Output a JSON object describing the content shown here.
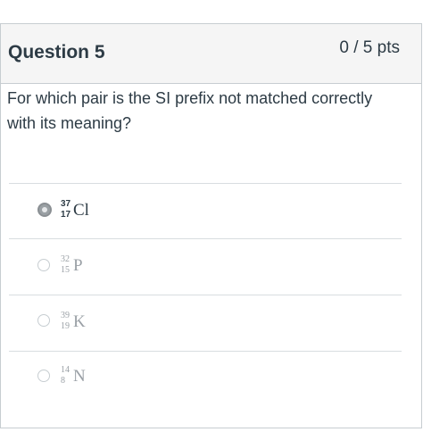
{
  "question": {
    "title": "Question 5",
    "points": "0 / 5 pts",
    "text": "For which pair is the SI prefix not matched correctly with its meaning?"
  },
  "answers": [
    {
      "mass": "37",
      "atomic": "17",
      "symbol": "Cl",
      "selected": true
    },
    {
      "mass": "32",
      "atomic": "15",
      "symbol": "P",
      "selected": false
    },
    {
      "mass": "39",
      "atomic": "19",
      "symbol": "K",
      "selected": false
    },
    {
      "mass": "14",
      "atomic": "8",
      "symbol": "N",
      "selected": false
    }
  ]
}
